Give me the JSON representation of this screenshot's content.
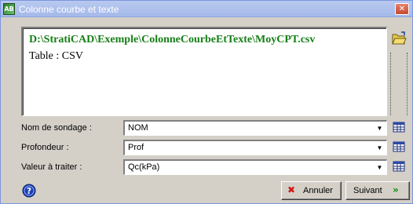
{
  "window": {
    "title": "Colonne courbe et texte",
    "app_icon_text": "AB",
    "close_glyph": "✕"
  },
  "file_info": {
    "path": "D:\\StratiCAD\\Exemple\\ColonneCourbeEtTexte\\MoyCPT.csv",
    "table": "Table : CSV"
  },
  "fields": [
    {
      "label": "Nom de sondage :",
      "value": "NOM"
    },
    {
      "label": "Profondeur :",
      "value": "Prof"
    },
    {
      "label": "Valeur à traiter :",
      "value": "Qc(kPa)"
    }
  ],
  "buttons": {
    "cancel_label": "Annuler",
    "next_label": "Suivant",
    "cancel_glyph": "✖",
    "next_glyph": "»"
  },
  "icons": {
    "open_folder": "folder-open-icon",
    "grid": "grid-table-icon",
    "help": "help-icon",
    "dropdown_glyph": "▼"
  },
  "colors": {
    "path_text": "#157f15",
    "cancel_icon": "#d01818",
    "next_icon": "#0e8c0e"
  }
}
